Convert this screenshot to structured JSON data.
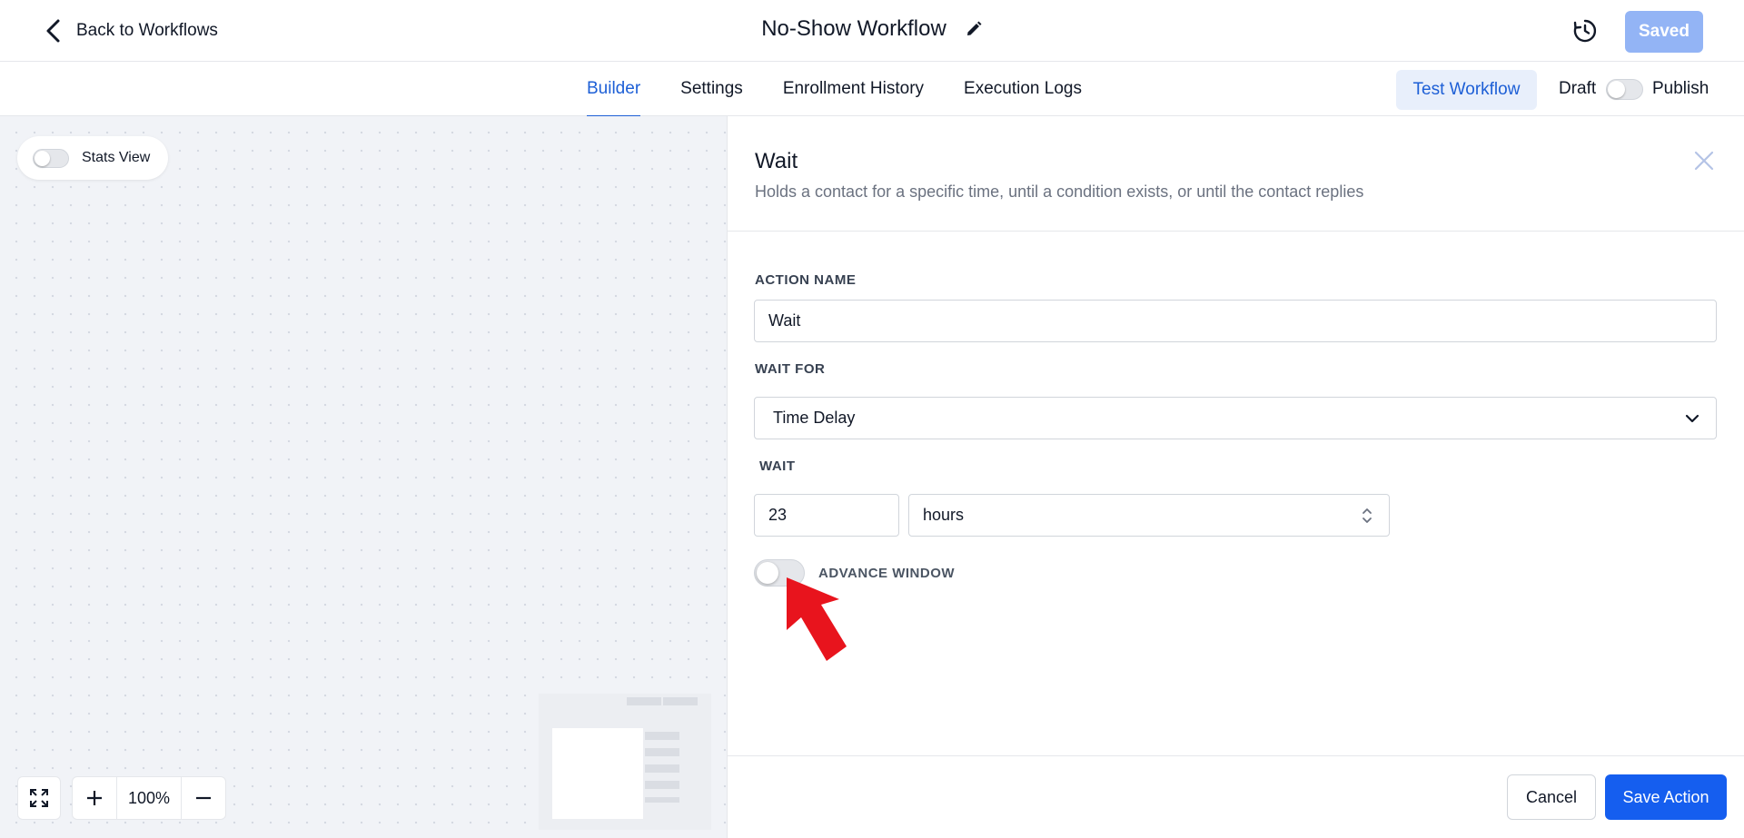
{
  "header": {
    "back_label": "Back to Workflows",
    "title": "No-Show Workflow",
    "saved_label": "Saved"
  },
  "nav": {
    "tabs": [
      {
        "label": "Builder",
        "active": true
      },
      {
        "label": "Settings",
        "active": false
      },
      {
        "label": "Enrollment History",
        "active": false
      },
      {
        "label": "Execution Logs",
        "active": false
      }
    ],
    "test_workflow_label": "Test Workflow",
    "draft_label": "Draft",
    "publish_label": "Publish",
    "published": false
  },
  "canvas": {
    "stats_view_label": "Stats View",
    "stats_view_on": false,
    "zoom_level": "100%"
  },
  "panel": {
    "title": "Wait",
    "description": "Holds a contact for a specific time, until a condition exists, or until the contact replies",
    "action_name_label": "ACTION NAME",
    "action_name_value": "Wait",
    "wait_for_label": "WAIT FOR",
    "wait_for_value": "Time Delay",
    "wait_label": "WAIT",
    "wait_amount": "23",
    "wait_unit": "hours",
    "advance_window_label": "ADVANCE WINDOW",
    "advance_window_on": false,
    "cancel_label": "Cancel",
    "save_label": "Save Action"
  },
  "colors": {
    "accent": "#155eef",
    "saved_disabled": "#93b4f5",
    "annotation_arrow": "#e8141d"
  }
}
